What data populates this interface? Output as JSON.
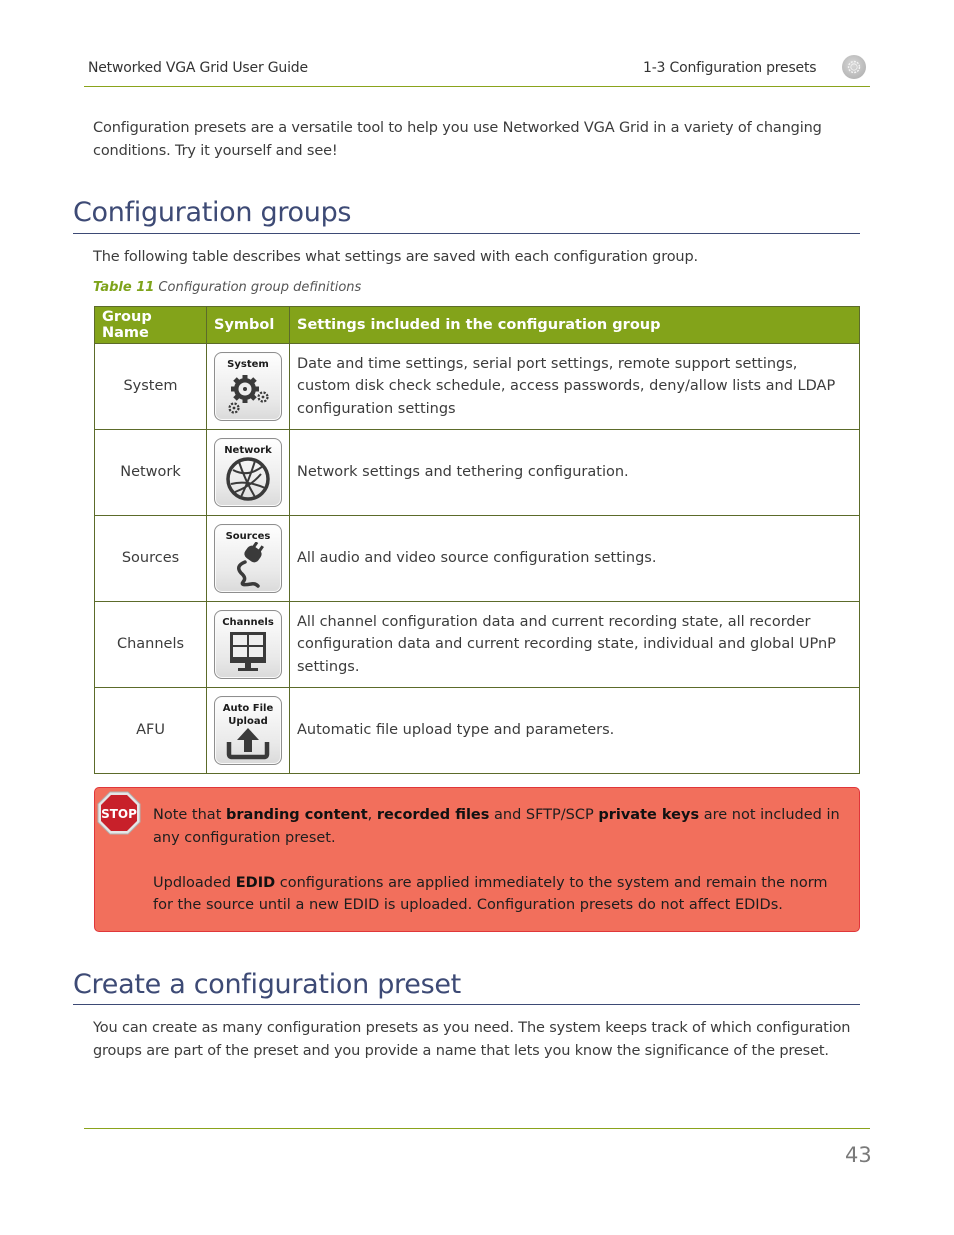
{
  "header": {
    "guide_title": "Networked VGA Grid User Guide",
    "section": "1-3 Configuration presets",
    "icon": "gear-badge-icon"
  },
  "intro": "Configuration presets are a versatile tool to help you use Networked VGA Grid in a variety of changing conditions. Try it yourself and see!",
  "section1": {
    "title": "Configuration groups",
    "text": "The following table describes what settings are saved with each configuration group.",
    "caption_label": "Table 11",
    "caption_text": " Configuration group definitions"
  },
  "table": {
    "headers": [
      "Group Name",
      "Symbol",
      "Settings included in the configuration group"
    ],
    "rows": [
      {
        "name": "System",
        "symbol_label": "System",
        "symbol_icon": "gears-icon",
        "description": "Date and time settings, serial port settings, remote support settings, custom disk check schedule, access passwords, deny/allow lists and LDAP configuration settings"
      },
      {
        "name": "Network",
        "symbol_label": "Network",
        "symbol_icon": "globe-network-icon",
        "description": "Network settings and tethering configuration."
      },
      {
        "name": "Sources",
        "symbol_label": "Sources",
        "symbol_icon": "plug-cable-icon",
        "description": "All audio and video source configuration settings."
      },
      {
        "name": "Channels",
        "symbol_label": "Channels",
        "symbol_icon": "monitor-grid-icon",
        "description": "All channel configuration data and current recording state, all recorder configuration data and current recording state, individual and global UPnP settings."
      },
      {
        "name": "AFU",
        "symbol_label_line1": "Auto File",
        "symbol_label_line2": "Upload",
        "symbol_icon": "upload-tray-icon",
        "description": "Automatic file upload type and parameters."
      }
    ]
  },
  "note": {
    "icon": "stop-sign-icon",
    "icon_text": "STOP",
    "p1": {
      "t1": "Note that ",
      "b1": "branding content",
      "t2": ", ",
      "b2": "recorded files",
      "t3": " and SFTP/SCP ",
      "b3": "private keys",
      "t4": " are not included in any configuration preset."
    },
    "p2": {
      "t1": "Updloaded ",
      "b1": "EDID",
      "t2": " configurations are applied immediately to the system and remain the norm for the source until a new EDID is uploaded. Configuration presets do not affect EDIDs."
    },
    "colors": {
      "background": "#f26f5c",
      "border": "#e0363a"
    }
  },
  "section2": {
    "title": "Create a configuration preset",
    "text": "You can create as many configuration presets as you need. The system keeps track of which configuration groups are part of the preset and you provide a name that lets you know the significance of the preset."
  },
  "footer": {
    "page_number": "43"
  },
  "colors": {
    "accent_green": "#83a31a",
    "heading_blue": "#3d4a75"
  }
}
